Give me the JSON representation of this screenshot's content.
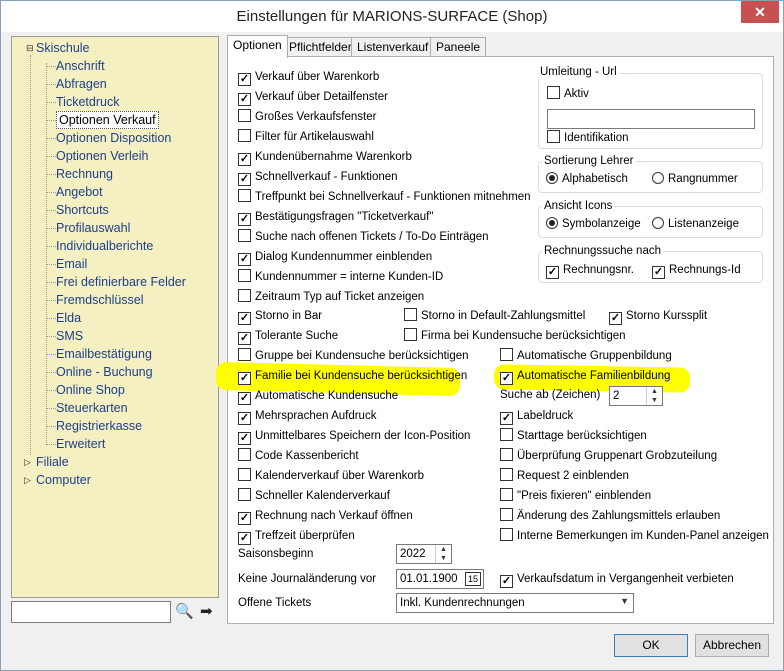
{
  "window": {
    "title": "Einstellungen für MARIONS-SURFACE (Shop)",
    "close": "✕"
  },
  "tree": {
    "root": "Skischule",
    "children": [
      "Anschrift",
      "Abfragen",
      "Ticketdruck",
      "Optionen Verkauf",
      "Optionen Disposition",
      "Optionen Verleih",
      "Rechnung",
      "Angebot",
      "Shortcuts",
      "Profilauswahl",
      "Individualberichte",
      "Email",
      "Frei definierbare Felder",
      "Fremdschlüssel",
      "Elda",
      "SMS",
      "Emailbestätigung",
      "Online - Buchung",
      "Online Shop",
      "Steuerkarten",
      "Registrierkasse",
      "Erweitert"
    ],
    "selected_index": 3,
    "other_roots": [
      "Filiale",
      "Computer"
    ],
    "expander_open": "⊟",
    "expander_closed": "▷"
  },
  "search": {
    "value": "",
    "search_icon": "🔍",
    "go_icon": "➡"
  },
  "tabs": [
    "Optionen",
    "Pflichtfelder",
    "Listenverkauf",
    "Paneele"
  ],
  "left_checks": [
    {
      "label": "Verkauf über Warenkorb",
      "checked": true
    },
    {
      "label": "Verkauf über Detailfenster",
      "checked": true
    },
    {
      "label": "Großes Verkaufsfenster",
      "checked": false
    },
    {
      "label": "Filter für Artikelauswahl",
      "checked": false
    },
    {
      "label": "Kundenübernahme Warenkorb",
      "checked": true
    },
    {
      "label": "Schnellverkauf - Funktionen",
      "checked": true
    },
    {
      "label": "Treffpunkt bei Schnellverkauf - Funktionen mitnehmen",
      "checked": false
    },
    {
      "label": "Bestätigungsfragen \"Ticketverkauf\"",
      "checked": true
    },
    {
      "label": "Suche nach offenen Tickets / To-Do Einträgen",
      "checked": false
    },
    {
      "label": "Dialog Kundennummer einblenden",
      "checked": true
    },
    {
      "label": "Kundennummer = interne Kunden-ID",
      "checked": false
    },
    {
      "label": "Zeitraum Typ auf Ticket anzeigen",
      "checked": false
    }
  ],
  "umleitung": {
    "title": "Umleitung - Url",
    "aktiv_label": "Aktiv",
    "aktiv": false,
    "url": "",
    "ident_label": "Identifikation",
    "ident": false
  },
  "sortierung": {
    "title": "Sortierung Lehrer",
    "options": [
      "Alphabetisch",
      "Rangnummer"
    ],
    "selected": 0
  },
  "ansicht": {
    "title": "Ansicht Icons",
    "options": [
      "Symbolanzeige",
      "Listenanzeige"
    ],
    "selected": 0
  },
  "rechnungssuche": {
    "title": "Rechnungssuche nach",
    "options": [
      {
        "label": "Rechnungsnr.",
        "checked": true
      },
      {
        "label": "Rechnungs-Id",
        "checked": true
      }
    ]
  },
  "row_storno": [
    {
      "label": "Storno in Bar",
      "checked": true
    },
    {
      "label": "Storno in Default-Zahlungsmittel",
      "checked": false
    },
    {
      "label": "Storno Kurssplit",
      "checked": true
    }
  ],
  "row_tolerant": [
    {
      "label": "Tolerante Suche",
      "checked": true
    },
    {
      "label": "Firma bei Kundensuche berücksichtigen",
      "checked": false
    }
  ],
  "col_left": [
    {
      "label": "Gruppe bei Kundensuche berücksichtigen",
      "checked": false
    },
    {
      "label": "Familie bei Kundensuche berücksichtigen",
      "checked": true
    },
    {
      "label": "Automatische Kundensuche",
      "checked": true
    },
    {
      "label": "Mehrsprachen Aufdruck",
      "checked": true
    },
    {
      "label": "Unmittelbares Speichern der Icon-Position",
      "checked": true
    },
    {
      "label": "Code Kassenbericht",
      "checked": false
    },
    {
      "label": "Kalenderverkauf über Warenkorb",
      "checked": false
    },
    {
      "label": "Schneller Kalenderverkauf",
      "checked": false
    },
    {
      "label": "Rechnung nach Verkauf öffnen",
      "checked": true
    },
    {
      "label": "Treffzeit überprüfen",
      "checked": true
    }
  ],
  "col_right_top": [
    {
      "label": "Automatische Gruppenbildung",
      "checked": false
    },
    {
      "label": "Automatische Familienbildung",
      "checked": true
    }
  ],
  "suche_ab": {
    "label": "Suche ab (Zeichen)",
    "value": "2"
  },
  "col_right": [
    {
      "label": "Labeldruck",
      "checked": true
    },
    {
      "label": "Starttage berücksichtigen",
      "checked": false
    },
    {
      "label": "Überprüfung Gruppenart Grobzuteilung",
      "checked": false
    },
    {
      "label": "Request 2 einblenden",
      "checked": false
    },
    {
      "label": "\"Preis fixieren\" einblenden",
      "checked": false
    },
    {
      "label": "Änderung des Zahlungsmittels erlauben",
      "checked": false
    },
    {
      "label": "Interne Bemerkungen im Kunden-Panel anzeigen",
      "checked": false
    }
  ],
  "saisonsbeginn": {
    "label": "Saisonsbeginn",
    "value": "2022"
  },
  "journal": {
    "label": "Keine Journaländerung vor",
    "value": "01.01.1900",
    "cal_icon": "15"
  },
  "vergangenheit": {
    "label": "Verkaufsdatum in Vergangenheit verbieten",
    "checked": true
  },
  "offene": {
    "label": "Offene Tickets",
    "value": "Inkl. Kundenrechnungen"
  },
  "buttons": {
    "ok": "OK",
    "cancel": "Abbrechen"
  },
  "highlight_color": "#ffff00"
}
